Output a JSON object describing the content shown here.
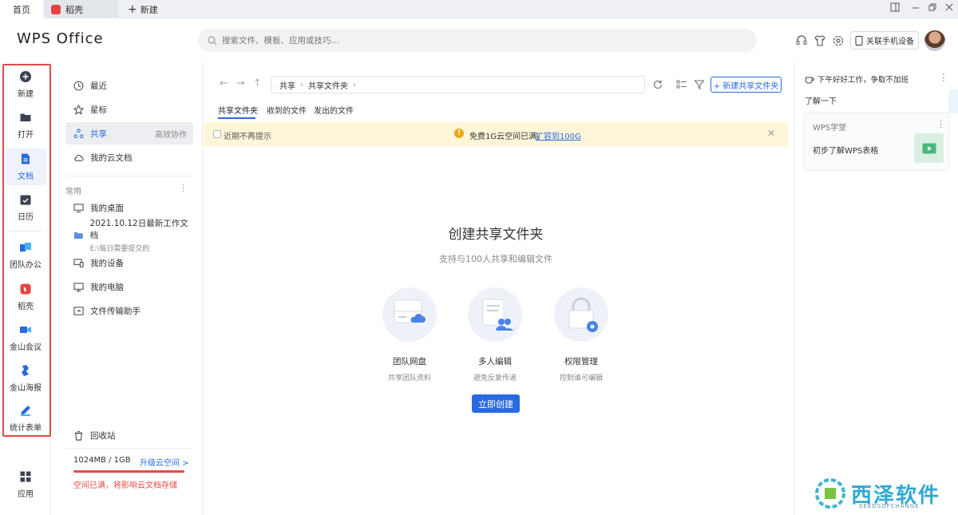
{
  "tabs": [
    {
      "label": "首页"
    },
    {
      "label": "稻壳"
    },
    {
      "label": "新建"
    }
  ],
  "brand": "WPS Office",
  "search": {
    "placeholder": "搜索文件、模板、应用或技巧..."
  },
  "header": {
    "link_phone": "关联手机设备"
  },
  "appbar": [
    {
      "label": "新建",
      "icon": "plus-circle-icon"
    },
    {
      "label": "打开",
      "icon": "folder-icon"
    },
    {
      "label": "文档",
      "icon": "document-icon",
      "active": true
    },
    {
      "label": "日历",
      "icon": "calendar-icon"
    },
    {
      "label": "团队办公",
      "icon": "team-office-icon"
    },
    {
      "label": "稻壳",
      "icon": "daoke-icon"
    },
    {
      "label": "金山会议",
      "icon": "meeting-icon"
    },
    {
      "label": "金山海报",
      "icon": "poster-icon"
    },
    {
      "label": "统计表单",
      "icon": "form-icon"
    },
    {
      "label": "应用",
      "icon": "apps-grid-icon"
    }
  ],
  "nav": {
    "top": [
      {
        "label": "最近",
        "icon": "clock-icon"
      },
      {
        "label": "星标",
        "icon": "star-icon"
      },
      {
        "label": "共享",
        "icon": "share-icon",
        "right": "高效协作",
        "active": true
      },
      {
        "label": "我的云文档",
        "icon": "cloud-icon"
      }
    ],
    "section_label": "常用",
    "common": [
      {
        "label": "我的桌面",
        "icon": "desktop-icon"
      },
      {
        "label": "2021.10.12日最新工作文档",
        "sub": "E:\\每日需要提交的",
        "icon": "folder-blue-icon"
      },
      {
        "label": "我的设备",
        "icon": "device-icon"
      },
      {
        "label": "我的电脑",
        "icon": "computer-icon"
      },
      {
        "label": "文件传输助手",
        "icon": "transfer-icon"
      }
    ],
    "recycle": "回收站",
    "storage": {
      "used": "1024MB / 1GB",
      "upgrade": "升级云空间 >",
      "fill_fraction": 1.0,
      "warning": "空间已满，将影响云文档存储"
    }
  },
  "main": {
    "path": [
      "共享",
      "共享文件夹"
    ],
    "new_share_button": "+ 新建共享文件夹",
    "subtabs": [
      "共享文件夹",
      "收到的文件",
      "发出的文件"
    ],
    "notice": {
      "checkbox_label": "近期不再提示",
      "text": "免费1G云空间已满，",
      "link": "扩容到100G"
    },
    "empty": {
      "title": "创建共享文件夹",
      "subtitle": "支持与100人共享和编辑文件",
      "features": [
        {
          "name": "团队网盘",
          "desc": "共享团队资料"
        },
        {
          "name": "多人编辑",
          "desc": "避免反复传递"
        },
        {
          "name": "权限管理",
          "desc": "控制谁可编辑"
        }
      ],
      "create_button": "立即创建"
    }
  },
  "right": {
    "greeting": "下午好好工作，争取不加班",
    "learn": "了解一下",
    "card": {
      "title": "WPS学堂",
      "text": "初步了解WPS表格"
    }
  },
  "watermark": {
    "text": "西泽软件",
    "sub": "SEEDSOFCHANGE"
  },
  "colors": {
    "accent": "#2a6ae0",
    "warning": "#e74a42",
    "notice_bg": "#fdf6d8"
  }
}
